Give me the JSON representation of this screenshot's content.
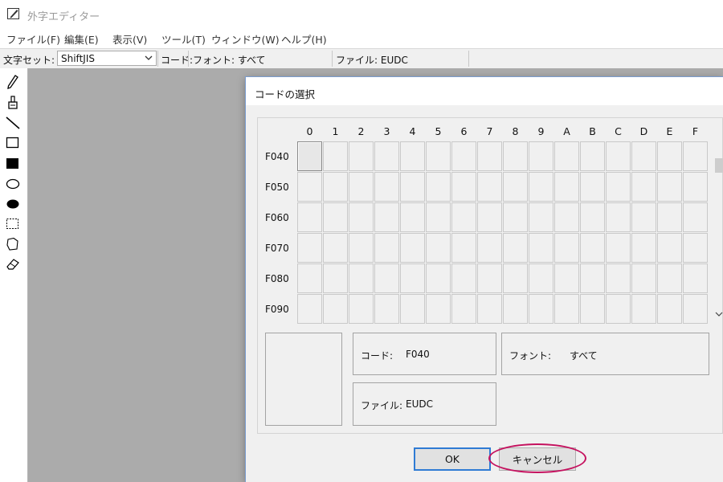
{
  "window": {
    "title": "外字エディター"
  },
  "menubar": {
    "items": [
      {
        "label": "ファイル(F)"
      },
      {
        "label": "編集(E)"
      },
      {
        "label": "表示(V)"
      },
      {
        "label": "ツール(T)"
      },
      {
        "label": "ウィンドウ(W)"
      },
      {
        "label": "ヘルプ(H)"
      }
    ]
  },
  "infobar": {
    "charset_label": "文字セット:",
    "charset_value": "ShiftJIS",
    "code_label": "コード:",
    "font_text": "フォント: すべて",
    "file_text": "ファイル: EUDC"
  },
  "tools": [
    {
      "icon": "pencil-icon"
    },
    {
      "icon": "brush-icon"
    },
    {
      "icon": "line-icon"
    },
    {
      "icon": "hollow-rectangle-icon"
    },
    {
      "icon": "filled-rectangle-icon"
    },
    {
      "icon": "hollow-ellipse-icon"
    },
    {
      "icon": "filled-ellipse-icon"
    },
    {
      "icon": "rectangular-selection-icon"
    },
    {
      "icon": "freeform-selection-icon"
    },
    {
      "icon": "eraser-icon"
    }
  ],
  "dialog": {
    "title": "コードの選択",
    "columns": [
      "0",
      "1",
      "2",
      "3",
      "4",
      "5",
      "6",
      "7",
      "8",
      "9",
      "A",
      "B",
      "C",
      "D",
      "E",
      "F"
    ],
    "rows": [
      "F040",
      "F050",
      "F060",
      "F070",
      "F080",
      "F090"
    ],
    "selected_cell": {
      "row": "F040",
      "column": "0"
    },
    "code_label": "コード:",
    "code_value": "F040",
    "font_label": "フォント:",
    "font_value": "すべて",
    "file_label": "ファイル:",
    "file_value": "EUDC",
    "ok_button": "OK",
    "cancel_button": "キャンセル"
  },
  "colors": {
    "workspace": "#ababab",
    "dialog_background": "#f0f0f0",
    "default_button_border": "#2f7bd4",
    "highlight_ring": "#c5125f"
  }
}
